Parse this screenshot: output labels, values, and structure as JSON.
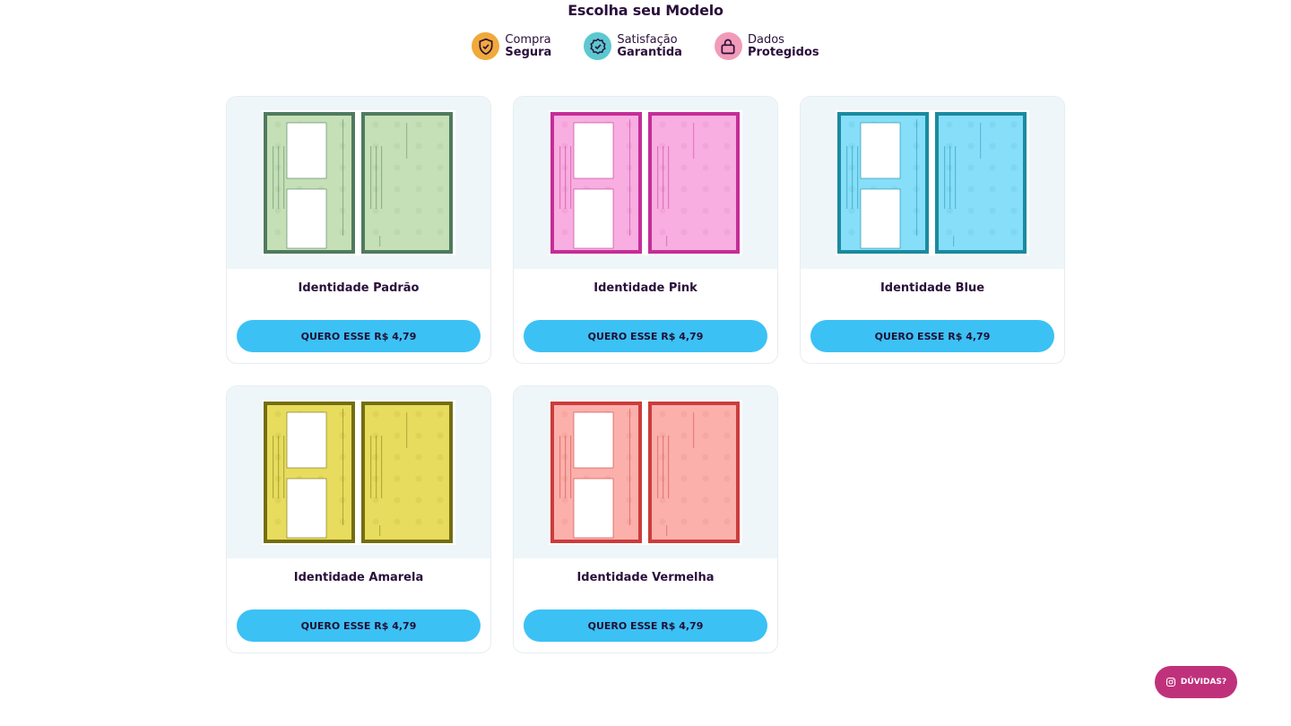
{
  "header": {
    "title": "Escolha seu Modelo"
  },
  "badges": [
    {
      "line1": "Compra",
      "line2": "Segura",
      "icon": "shield-check-icon",
      "color": "#f0a93b",
      "iconColor": "#2a0f3a"
    },
    {
      "line1": "Satisfação",
      "line2": "Garantida",
      "icon": "check-badge-icon",
      "color": "#5cc8cf",
      "iconColor": "#2a0f3a"
    },
    {
      "line1": "Dados",
      "line2": "Protegidos",
      "icon": "lock-icon",
      "color": "#f29bb9",
      "iconColor": "#2a0f3a"
    }
  ],
  "products": [
    {
      "title": "Identidade Padrão",
      "button": "QUERO ESSE R$ 4,79",
      "frame": "#4f7a5f",
      "fill": "#c5e0b6"
    },
    {
      "title": "Identidade Pink",
      "button": "QUERO ESSE R$ 4,79",
      "frame": "#c42e97",
      "fill": "#f8aee0"
    },
    {
      "title": "Identidade Blue",
      "button": "QUERO ESSE R$ 4,79",
      "frame": "#1a8a9f",
      "fill": "#86def9"
    },
    {
      "title": "Identidade Amarela",
      "button": "QUERO ESSE R$ 4,79",
      "frame": "#736e10",
      "fill": "#e8dc5e"
    },
    {
      "title": "Identidade Vermelha",
      "button": "QUERO ESSE R$ 4,79",
      "frame": "#cc3c3c",
      "fill": "#fbb0ab"
    }
  ],
  "help": {
    "label": "DÚVIDAS?",
    "icon": "instagram-icon"
  }
}
